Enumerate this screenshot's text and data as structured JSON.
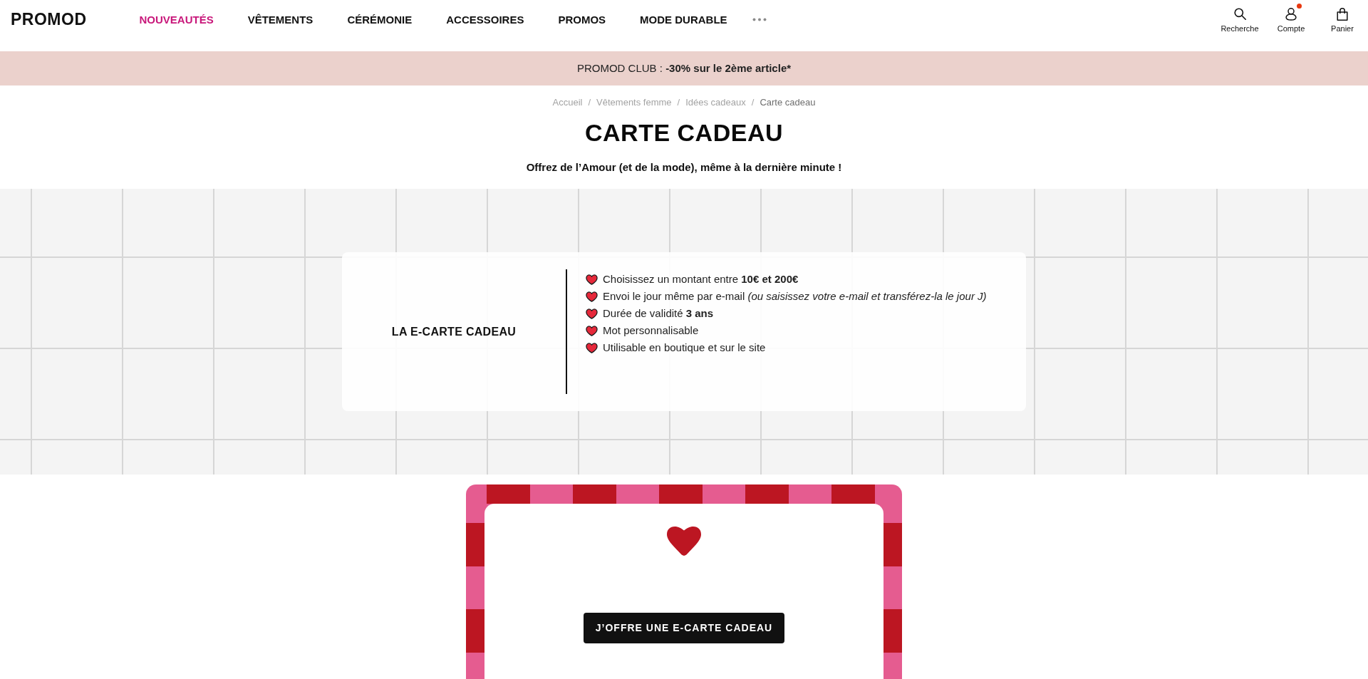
{
  "header": {
    "logo": "PROMOD",
    "nav": [
      {
        "label": "NOUVEAUTÉS",
        "highlighted": true
      },
      {
        "label": "VÊTEMENTS",
        "highlighted": false
      },
      {
        "label": "CÉRÉMONIE",
        "highlighted": false
      },
      {
        "label": "ACCESSOIRES",
        "highlighted": false
      },
      {
        "label": "PROMOS",
        "highlighted": false
      },
      {
        "label": "MODE DURABLE",
        "highlighted": false
      }
    ],
    "actions": [
      {
        "kind": "search",
        "label": "Recherche",
        "notification": false
      },
      {
        "kind": "account",
        "label": "Compte",
        "notification": true
      },
      {
        "kind": "bag",
        "label": "Panier",
        "notification": false
      }
    ]
  },
  "promo_banner": {
    "label": "PROMOD CLUB :",
    "offer": "-30% sur le 2ème article*"
  },
  "breadcrumb": {
    "separator": "/",
    "items": [
      {
        "label": "Accueil",
        "current": false
      },
      {
        "label": "Vêtements femme",
        "current": false
      },
      {
        "label": "Idées cadeaux",
        "current": false
      },
      {
        "label": "Carte cadeau",
        "current": true
      }
    ]
  },
  "title": "CARTE CADEAU",
  "subtitle": "Offrez de l’Amour (et de la mode), même à la dernière minute !",
  "info_card": {
    "title": "LA E-CARTE CADEAU",
    "features": [
      "Choisissez un montant entre **10€ et 200€**",
      "Envoi le jour même par e-mail *(ou saisissez votre e-mail et transférez-la le jour J)*",
      "Durée de validité **3 ans**",
      "Mot personnalisable",
      "Utilisable en boutique et sur le site"
    ]
  },
  "gift_card": {
    "button": "J’OFFRE UNE E-CARTE CADEAU"
  }
}
